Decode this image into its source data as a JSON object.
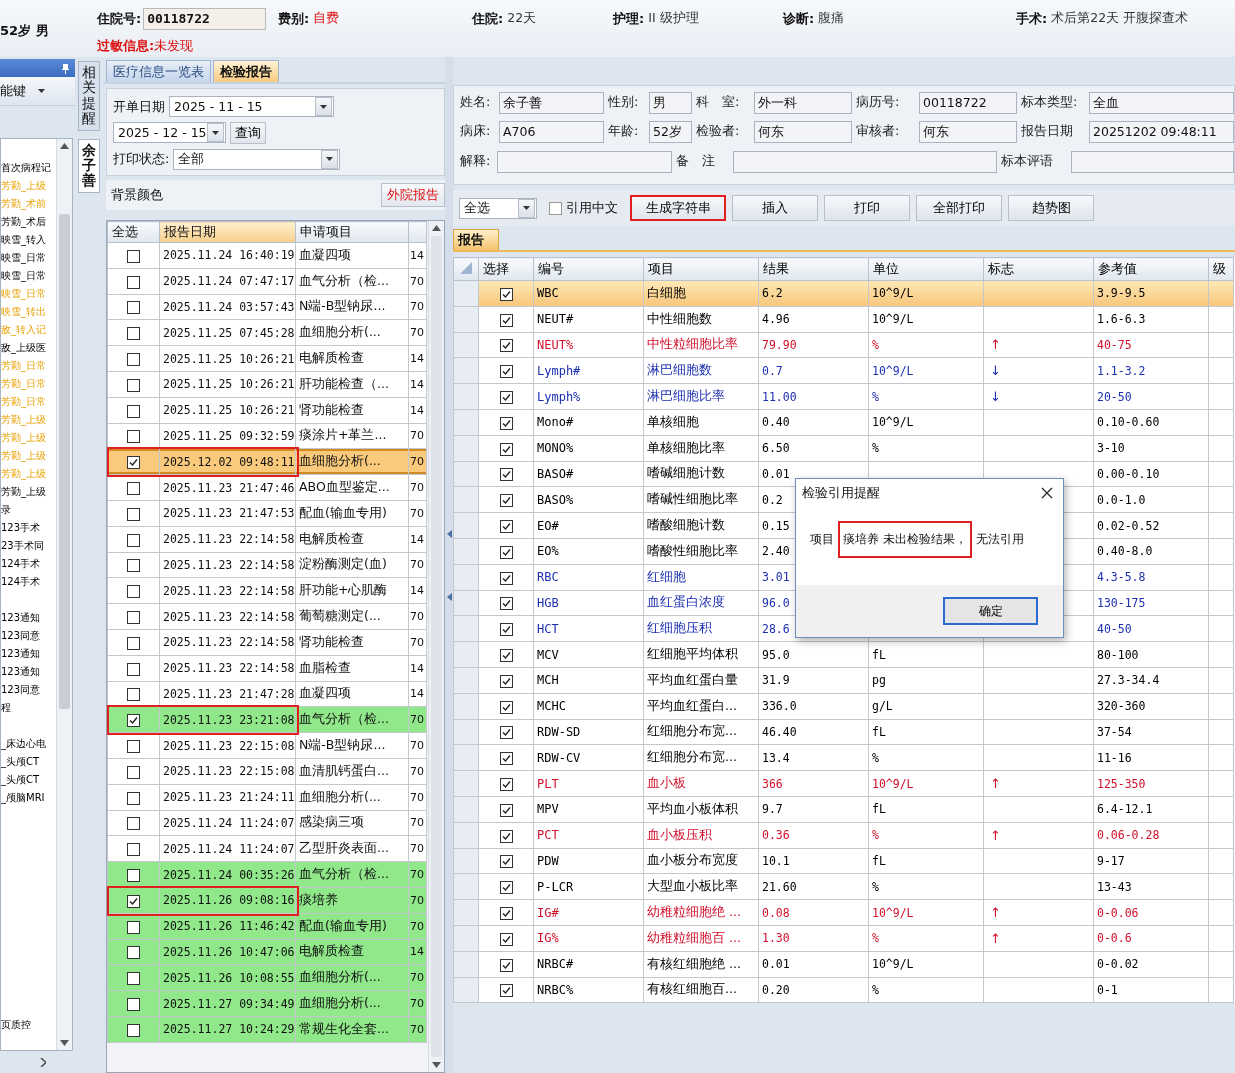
{
  "header": {
    "age_sex": "52岁 男",
    "inpatient_no": {
      "label": "住院号:",
      "value": "00118722"
    },
    "items": [
      {
        "label": "费别:",
        "value": "自费",
        "kind": "alert"
      },
      {
        "label": "住院:",
        "value": "22天",
        "kind": "plain"
      },
      {
        "label": "护理:",
        "value": "II 级护理",
        "kind": "plain"
      },
      {
        "label": "诊断:",
        "value": "腹痛",
        "kind": "plain"
      },
      {
        "label": "手术:",
        "value": "术后第22天 开腹探查术",
        "kind": "plain"
      }
    ],
    "allergy": {
      "label": "过敏信息:",
      "value": "未发现"
    }
  },
  "sidebar": {
    "function_key": "能键",
    "groups": [
      [
        {
          "text": "首次病程记",
          "flagged": false
        },
        {
          "text": "芳勤_上级",
          "flagged": true
        },
        {
          "text": "芳勤_术前",
          "flagged": true
        },
        {
          "text": "芳勤_术后",
          "flagged": false
        },
        {
          "text": "映雪_转入",
          "flagged": false
        },
        {
          "text": "映雪_日常",
          "flagged": false
        },
        {
          "text": "映雪_日常",
          "flagged": false
        },
        {
          "text": "映雪_日常",
          "flagged": true
        },
        {
          "text": "映雪_转出",
          "flagged": true
        },
        {
          "text": "敌_转入记",
          "flagged": true
        },
        {
          "text": "敌_上级医",
          "flagged": false
        },
        {
          "text": "芳勤_日常",
          "flagged": true
        },
        {
          "text": "芳勤_日常",
          "flagged": true
        },
        {
          "text": "芳勤_日常",
          "flagged": true
        },
        {
          "text": "芳勤_上级",
          "flagged": true
        },
        {
          "text": "芳勤_上级",
          "flagged": true
        },
        {
          "text": "芳勤_上级",
          "flagged": true
        },
        {
          "text": "芳勤_上级",
          "flagged": true
        },
        {
          "text": "芳勤_上级",
          "flagged": false
        },
        {
          "text": "录",
          "flagged": false
        },
        {
          "text": "123手术",
          "flagged": false
        },
        {
          "text": "23手术同",
          "flagged": false
        },
        {
          "text": "124手术",
          "flagged": false
        },
        {
          "text": "124手术",
          "flagged": false
        }
      ],
      [
        {
          "text": "123通知",
          "flagged": false
        },
        {
          "text": "123同意",
          "flagged": false
        },
        {
          "text": "123通知",
          "flagged": false
        },
        {
          "text": "123通知",
          "flagged": false
        },
        {
          "text": "123同意",
          "flagged": false
        },
        {
          "text": "程",
          "flagged": false
        }
      ],
      [
        {
          "text": "_床边心电",
          "flagged": false
        },
        {
          "text": "_头颅CT",
          "flagged": false
        },
        {
          "text": "_头颅CT",
          "flagged": false
        },
        {
          "text": "_颅脑MRI",
          "flagged": false
        }
      ],
      [
        {
          "text": "页质控",
          "flagged": false
        }
      ]
    ]
  },
  "side_tabs": [
    {
      "label": "相关提醒",
      "selected": false
    },
    {
      "label": "余子善",
      "selected": true
    }
  ],
  "tabs": [
    {
      "label": "医疗信息一览表",
      "selected": false
    },
    {
      "label": "检验报告",
      "selected": true
    }
  ],
  "query": {
    "start_label": "开单日期",
    "start": "2025 - 11 - 15",
    "end": "2025 - 12 - 15",
    "search_button": "查询",
    "print_label": "打印状态:",
    "print_status": "全部",
    "bg_label": "背景颜色",
    "external_button": "外院报告"
  },
  "lab_list": {
    "columns": [
      "全选",
      "报告日期",
      "申请项目"
    ],
    "rows": [
      {
        "date": "2025.11.24 16:40:19",
        "item": "血凝四项",
        "column_4": "14",
        "checked": false,
        "selected": false,
        "color": "#ffffff",
        "highlighted": false
      },
      {
        "date": "2025.11.24 07:47:17",
        "item": "血气分析（检...",
        "column_4": "70",
        "checked": false,
        "selected": false,
        "color": "#ffffff",
        "highlighted": false
      },
      {
        "date": "2025.11.24 03:57:43",
        "item": "N端-B型钠尿...",
        "column_4": "70",
        "checked": false,
        "selected": false,
        "color": "#ffffff",
        "highlighted": false
      },
      {
        "date": "2025.11.25 07:45:28",
        "item": "血细胞分析(...",
        "column_4": "70",
        "checked": false,
        "selected": false,
        "color": "#ffffff",
        "highlighted": false
      },
      {
        "date": "2025.11.25 10:26:21",
        "item": "电解质检查",
        "column_4": "14",
        "checked": false,
        "selected": false,
        "color": "#ffffff",
        "highlighted": false
      },
      {
        "date": "2025.11.25 10:26:21",
        "item": "肝功能检查（...",
        "column_4": "14",
        "checked": false,
        "selected": false,
        "color": "#ffffff",
        "highlighted": false
      },
      {
        "date": "2025.11.25 10:26:21",
        "item": "肾功能检查",
        "column_4": "14",
        "checked": false,
        "selected": false,
        "color": "#ffffff",
        "highlighted": false
      },
      {
        "date": "2025.11.25 09:32:59",
        "item": "痰涂片+革兰...",
        "column_4": "70",
        "checked": false,
        "selected": false,
        "color": "#ffffff",
        "highlighted": false
      },
      {
        "date": "2025.12.02 09:48:11",
        "item": "血细胞分析(...",
        "column_4": "70",
        "checked": true,
        "selected": true,
        "color": "#f9c97c",
        "highlighted": true
      },
      {
        "date": "2025.11.23 21:47:46",
        "item": "ABO血型鉴定...",
        "column_4": "70",
        "checked": false,
        "selected": false,
        "color": "#ffffff",
        "highlighted": false
      },
      {
        "date": "2025.11.23 21:47:53",
        "item": "配血(输血专用)",
        "column_4": "70",
        "checked": false,
        "selected": false,
        "color": "#ffffff",
        "highlighted": false
      },
      {
        "date": "2025.11.23 22:14:58",
        "item": "电解质检查",
        "column_4": "14",
        "checked": false,
        "selected": false,
        "color": "#ffffff",
        "highlighted": false
      },
      {
        "date": "2025.11.23 22:14:58",
        "item": "淀粉酶测定(血)",
        "column_4": "70",
        "checked": false,
        "selected": false,
        "color": "#ffffff",
        "highlighted": false
      },
      {
        "date": "2025.11.23 22:14:58",
        "item": "肝功能+心肌酶",
        "column_4": "14",
        "checked": false,
        "selected": false,
        "color": "#ffffff",
        "highlighted": false
      },
      {
        "date": "2025.11.23 22:14:58",
        "item": "葡萄糖测定(...",
        "column_4": "70",
        "checked": false,
        "selected": false,
        "color": "#ffffff",
        "highlighted": false
      },
      {
        "date": "2025.11.23 22:14:58",
        "item": "肾功能检查",
        "column_4": "70",
        "checked": false,
        "selected": false,
        "color": "#ffffff",
        "highlighted": false
      },
      {
        "date": "2025.11.23 22:14:58",
        "item": "血脂检查",
        "column_4": "14",
        "checked": false,
        "selected": false,
        "color": "#ffffff",
        "highlighted": false
      },
      {
        "date": "2025.11.23 21:47:28",
        "item": "血凝四项",
        "column_4": "14",
        "checked": false,
        "selected": false,
        "color": "#ffffff",
        "highlighted": false
      },
      {
        "date": "2025.11.23 23:21:08",
        "item": "血气分析（检...",
        "column_4": "70",
        "checked": true,
        "selected": false,
        "color": "#90e88a",
        "highlighted": true
      },
      {
        "date": "2025.11.23 22:15:08",
        "item": "N端-B型钠尿...",
        "column_4": "70",
        "checked": false,
        "selected": false,
        "color": "#ffffff",
        "highlighted": false
      },
      {
        "date": "2025.11.23 22:15:08",
        "item": "血清肌钙蛋白...",
        "column_4": "70",
        "checked": false,
        "selected": false,
        "color": "#ffffff",
        "highlighted": false
      },
      {
        "date": "2025.11.23 21:24:11",
        "item": "血细胞分析(...",
        "column_4": "70",
        "checked": false,
        "selected": false,
        "color": "#ffffff",
        "highlighted": false
      },
      {
        "date": "2025.11.24 11:24:07",
        "item": "感染病三项",
        "column_4": "70",
        "checked": false,
        "selected": false,
        "color": "#ffffff",
        "highlighted": false
      },
      {
        "date": "2025.11.24 11:24:07",
        "item": "乙型肝炎表面...",
        "column_4": "70",
        "checked": false,
        "selected": false,
        "color": "#ffffff",
        "highlighted": false
      },
      {
        "date": "2025.11.24 00:35:26",
        "item": "血气分析（检...",
        "column_4": "70",
        "checked": false,
        "selected": false,
        "color": "#90e88a",
        "highlighted": false
      },
      {
        "date": "2025.11.26 09:08:16",
        "item": "痰培养",
        "column_4": "70",
        "checked": true,
        "selected": false,
        "color": "#90e88a",
        "highlighted": true
      },
      {
        "date": "2025.11.26 11:46:42",
        "item": "配血(输血专用)",
        "column_4": "70",
        "checked": false,
        "selected": false,
        "color": "#90e88a",
        "highlighted": false
      },
      {
        "date": "2025.11.26 10:47:06",
        "item": "电解质检查",
        "column_4": "14",
        "checked": false,
        "selected": false,
        "color": "#90e88a",
        "highlighted": false
      },
      {
        "date": "2025.11.26 10:08:55",
        "item": "血细胞分析(...",
        "column_4": "70",
        "checked": false,
        "selected": false,
        "color": "#90e88a",
        "highlighted": false
      },
      {
        "date": "2025.11.27 09:34:49",
        "item": "血细胞分析(...",
        "column_4": "70",
        "checked": false,
        "selected": false,
        "color": "#90e88a",
        "highlighted": false
      },
      {
        "date": "2025.11.27 10:24:29",
        "item": "常规生化全套...",
        "column_4": "70",
        "checked": false,
        "selected": false,
        "color": "#90e88a",
        "highlighted": false
      }
    ]
  },
  "report_form": {
    "fields": [
      {
        "label": "姓名:",
        "value": "余子善"
      },
      {
        "label": "性别:",
        "value": "男"
      },
      {
        "label": "科　室:",
        "value": "外一科"
      },
      {
        "label": "病历号:",
        "value": "00118722"
      },
      {
        "label": "标本类型:",
        "value": "全血"
      },
      {
        "label": "病床:",
        "value": "A706"
      },
      {
        "label": "年龄:",
        "value": "52岁"
      },
      {
        "label": "检验者:",
        "value": "何东"
      },
      {
        "label": "审核者:",
        "value": "何东"
      },
      {
        "label": "报告日期",
        "value": "20251202 09:48:11"
      }
    ],
    "notes": [
      {
        "label": "解释:"
      },
      {
        "label": "备　注"
      },
      {
        "label": "标本评语"
      }
    ]
  },
  "toolbar": {
    "select": "全选",
    "quote_checkbox": {
      "label": "引用中文",
      "checked": false
    },
    "buttons": [
      {
        "label": "生成字符串",
        "highlighted": true
      },
      {
        "label": "插入",
        "highlighted": false
      },
      {
        "label": "打印",
        "highlighted": false
      },
      {
        "label": "全部打印",
        "highlighted": false
      },
      {
        "label": "趋势图",
        "highlighted": false
      }
    ]
  },
  "report_tab": "报告",
  "results": {
    "columns": [
      "选择",
      "编号",
      "项目",
      "结果",
      "单位",
      "标志",
      "参考值",
      "级"
    ],
    "rows": [
      {
        "code": "WBC",
        "name": "白细胞",
        "result": "6.2",
        "unit": "10^9/L",
        "range": "3.9-9.5",
        "checked": true,
        "selected": true
      },
      {
        "code": "NEUT#",
        "name": "中性细胞数",
        "result": "4.96",
        "unit": "10^9/L",
        "range": "1.6-6.3",
        "color": "#000000",
        "checked": true,
        "selected": false
      },
      {
        "code": "NEUT%",
        "name": "中性粒细胞比率",
        "result": "79.90",
        "unit": "%",
        "flag": "↑",
        "range": "40-75",
        "color": "#d0102a",
        "checked": true,
        "selected": false
      },
      {
        "code": "Lymph#",
        "name": "淋巴细胞数",
        "result": "0.7",
        "unit": "10^9/L",
        "flag": "↓",
        "range": "1.1-3.2",
        "color": "#1c2fb0",
        "checked": true,
        "selected": false
      },
      {
        "code": "Lymph%",
        "name": "淋巴细胞比率",
        "result": "11.00",
        "unit": "%",
        "flag": "↓",
        "range": "20-50",
        "color": "#1c2fb0",
        "checked": true,
        "selected": false
      },
      {
        "code": "Mono#",
        "name": "单核细胞",
        "result": "0.40",
        "unit": "10^9/L",
        "range": "0.10-0.60",
        "color": "#000000",
        "checked": true,
        "selected": false
      },
      {
        "code": "MONO%",
        "name": "单核细胞比率",
        "result": "6.50",
        "unit": "%",
        "range": "3-10",
        "color": "#000000",
        "checked": true,
        "selected": false
      },
      {
        "code": "BASO#",
        "name": "嗜碱细胞计数",
        "result": "0.01",
        "range": "0.00-0.10",
        "color": "#000000",
        "checked": true,
        "selected": false
      },
      {
        "code": "BASO%",
        "name": "嗜碱性细胞比率",
        "result": "0.2",
        "range": "0.0-1.0",
        "color": "#000000",
        "checked": true,
        "selected": false
      },
      {
        "code": "EO#",
        "name": "嗜酸细胞计数",
        "result": "0.15",
        "range": "0.02-0.52",
        "color": "#000000",
        "checked": true,
        "selected": false
      },
      {
        "code": "EO%",
        "name": "嗜酸性细胞比率",
        "result": "2.40",
        "range": "0.40-8.0",
        "color": "#000000",
        "checked": true,
        "selected": false
      },
      {
        "code": "RBC",
        "name": "红细胞",
        "result": "3.01",
        "range": "4.3-5.8",
        "color": "#1c2fb0",
        "checked": true,
        "selected": false
      },
      {
        "code": "HGB",
        "name": "血红蛋白浓度",
        "result": "96.0",
        "range": "130-175",
        "color": "#1c2fb0",
        "checked": true,
        "selected": false
      },
      {
        "code": "HCT",
        "name": "红细胞压积",
        "result": "28.6",
        "range": "40-50",
        "color": "#1c2fb0",
        "checked": true,
        "selected": false
      },
      {
        "code": "MCV",
        "name": "红细胞平均体积",
        "result": "95.0",
        "unit": "fL",
        "range": "80-100",
        "color": "#000000",
        "checked": true,
        "selected": false
      },
      {
        "code": "MCH",
        "name": "平均血红蛋白量",
        "result": "31.9",
        "unit": "pg",
        "range": "27.3-34.4",
        "color": "#000000",
        "checked": true,
        "selected": false
      },
      {
        "code": "MCHC",
        "name": "平均血红蛋白...",
        "result": "336.0",
        "unit": "g/L",
        "range": "320-360",
        "color": "#000000",
        "checked": true,
        "selected": false
      },
      {
        "code": "RDW-SD",
        "name": "红细胞分布宽...",
        "result": "46.40",
        "unit": "fL",
        "range": "37-54",
        "color": "#000000",
        "checked": true,
        "selected": false
      },
      {
        "code": "RDW-CV",
        "name": "红细胞分布宽...",
        "result": "13.4",
        "unit": "%",
        "range": "11-16",
        "color": "#000000",
        "checked": true,
        "selected": false
      },
      {
        "code": "PLT",
        "name": "血小板",
        "result": "366",
        "unit": "10^9/L",
        "flag": "↑",
        "range": "125-350",
        "color": "#d0102a",
        "checked": true,
        "selected": false
      },
      {
        "code": "MPV",
        "name": "平均血小板体积",
        "result": "9.7",
        "unit": "fL",
        "range": "6.4-12.1",
        "color": "#000000",
        "checked": true,
        "selected": false
      },
      {
        "code": "PCT",
        "name": "血小板压积",
        "result": "0.36",
        "unit": "%",
        "flag": "↑",
        "range": "0.06-0.28",
        "color": "#d0102a",
        "checked": true,
        "selected": false
      },
      {
        "code": "PDW",
        "name": "血小板分布宽度",
        "result": "10.1",
        "unit": "fL",
        "range": "9-17",
        "color": "#000000",
        "checked": true,
        "selected": false
      },
      {
        "code": "P-LCR",
        "name": "大型血小板比率",
        "result": "21.60",
        "unit": "%",
        "range": "13-43",
        "color": "#000000",
        "checked": true,
        "selected": false
      },
      {
        "code": "IG#",
        "name": "幼稚粒细胞绝 ...",
        "result": "0.08",
        "unit": "10^9/L",
        "flag": "↑",
        "range": "0-0.06",
        "color": "#d0102a",
        "checked": true,
        "selected": false
      },
      {
        "code": "IG%",
        "name": "幼稚粒细胞百 ...",
        "result": "1.30",
        "unit": "%",
        "flag": "↑",
        "range": "0-0.6",
        "color": "#d0102a",
        "checked": true,
        "selected": false
      },
      {
        "code": "NRBC#",
        "name": "有核红细胞绝 ...",
        "result": "0.01",
        "unit": "10^9/L",
        "range": "0-0.02",
        "color": "#000000",
        "checked": true,
        "selected": false
      },
      {
        "code": "NRBC%",
        "name": "有核红细胞百...",
        "result": "0.20",
        "unit": "%",
        "range": "0-1",
        "color": "#000000",
        "checked": true,
        "selected": false
      }
    ]
  },
  "dialog": {
    "title": "检验引用提醒",
    "message_prefix": "项目",
    "message_highlight": "痰培养 未出检验结果，",
    "message_suffix": "无法引用",
    "ok_button": "确定"
  }
}
